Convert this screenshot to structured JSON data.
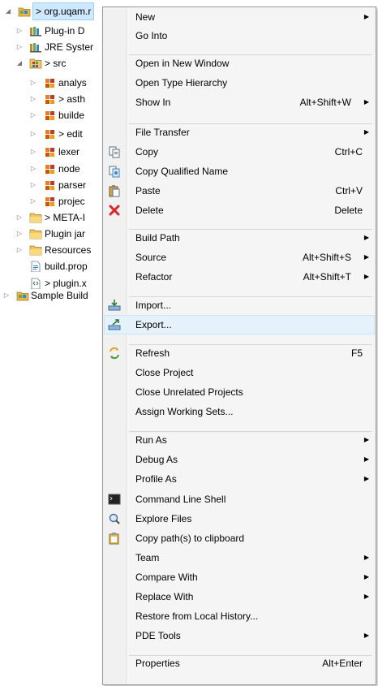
{
  "tree": {
    "items": [
      {
        "label": "> org.uqam.r",
        "icon": "project-icon"
      },
      {
        "label": "Plug-in D",
        "icon": "library-icon"
      },
      {
        "label": "JRE Syster",
        "icon": "library-icon"
      },
      {
        "label": "> src",
        "icon": "source-folder-icon"
      },
      {
        "label": "analys",
        "icon": "package-icon"
      },
      {
        "label": "> asth",
        "icon": "package-icon"
      },
      {
        "label": "builde",
        "icon": "package-icon"
      },
      {
        "label": "> edit",
        "icon": "package-icon"
      },
      {
        "label": "lexer",
        "icon": "package-icon"
      },
      {
        "label": "node",
        "icon": "package-icon"
      },
      {
        "label": "parser",
        "icon": "package-icon"
      },
      {
        "label": "projec",
        "icon": "package-icon"
      },
      {
        "label": "> META-I",
        "icon": "folder-icon"
      },
      {
        "label": "Plugin jar",
        "icon": "folder-icon"
      },
      {
        "label": "Resources",
        "icon": "folder-icon"
      },
      {
        "label": "build.prop",
        "icon": "properties-file-icon"
      },
      {
        "label": "> plugin.x",
        "icon": "xml-file-icon"
      },
      {
        "label": "Sample Build",
        "icon": "project-icon"
      }
    ]
  },
  "menu": {
    "items": [
      {
        "label": "New",
        "shortcut": "",
        "submenu": true
      },
      {
        "label": "Go Into",
        "shortcut": "",
        "submenu": false
      },
      {
        "label": "Open in New Window",
        "shortcut": "",
        "submenu": false
      },
      {
        "label": "Open Type Hierarchy",
        "shortcut": "",
        "submenu": false
      },
      {
        "label": "Show In",
        "shortcut": "Alt+Shift+W",
        "submenu": true
      },
      {
        "label": "File Transfer",
        "shortcut": "",
        "submenu": true
      },
      {
        "label": "Copy",
        "shortcut": "Ctrl+C",
        "submenu": false,
        "icon": "copy-icon"
      },
      {
        "label": "Copy Qualified Name",
        "shortcut": "",
        "submenu": false,
        "icon": "copy-qualified-name-icon"
      },
      {
        "label": "Paste",
        "shortcut": "Ctrl+V",
        "submenu": false,
        "icon": "paste-icon"
      },
      {
        "label": "Delete",
        "shortcut": "Delete",
        "submenu": false,
        "icon": "delete-icon"
      },
      {
        "label": "Build Path",
        "shortcut": "",
        "submenu": true
      },
      {
        "label": "Source",
        "shortcut": "Alt+Shift+S",
        "submenu": true
      },
      {
        "label": "Refactor",
        "shortcut": "Alt+Shift+T",
        "submenu": true
      },
      {
        "label": "Import...",
        "shortcut": "",
        "submenu": false,
        "icon": "import-icon"
      },
      {
        "label": "Export...",
        "shortcut": "",
        "submenu": false,
        "icon": "export-icon"
      },
      {
        "label": "Refresh",
        "shortcut": "F5",
        "submenu": false,
        "icon": "refresh-icon"
      },
      {
        "label": "Close Project",
        "shortcut": "",
        "submenu": false
      },
      {
        "label": "Close Unrelated Projects",
        "shortcut": "",
        "submenu": false
      },
      {
        "label": "Assign Working Sets...",
        "shortcut": "",
        "submenu": false
      },
      {
        "label": "Run As",
        "shortcut": "",
        "submenu": true
      },
      {
        "label": "Debug As",
        "shortcut": "",
        "submenu": true
      },
      {
        "label": "Profile As",
        "shortcut": "",
        "submenu": true
      },
      {
        "label": "Command Line Shell",
        "shortcut": "",
        "submenu": false,
        "icon": "terminal-icon"
      },
      {
        "label": "Explore Files",
        "shortcut": "",
        "submenu": false,
        "icon": "explore-files-icon"
      },
      {
        "label": "Copy path(s) to clipboard",
        "shortcut": "",
        "submenu": false,
        "icon": "clipboard-icon"
      },
      {
        "label": "Team",
        "shortcut": "",
        "submenu": true
      },
      {
        "label": "Compare With",
        "shortcut": "",
        "submenu": true
      },
      {
        "label": "Replace With",
        "shortcut": "",
        "submenu": true
      },
      {
        "label": "Restore from Local History...",
        "shortcut": "",
        "submenu": false
      },
      {
        "label": "PDE Tools",
        "shortcut": "",
        "submenu": true
      },
      {
        "label": "Properties",
        "shortcut": "Alt+Enter",
        "submenu": false
      }
    ]
  },
  "colors": {
    "menu_bg": "#f5f5f5",
    "hover_bg": "#e5f1fb",
    "selection_bg": "#cde8ff",
    "delete_red": "#d8262b"
  }
}
